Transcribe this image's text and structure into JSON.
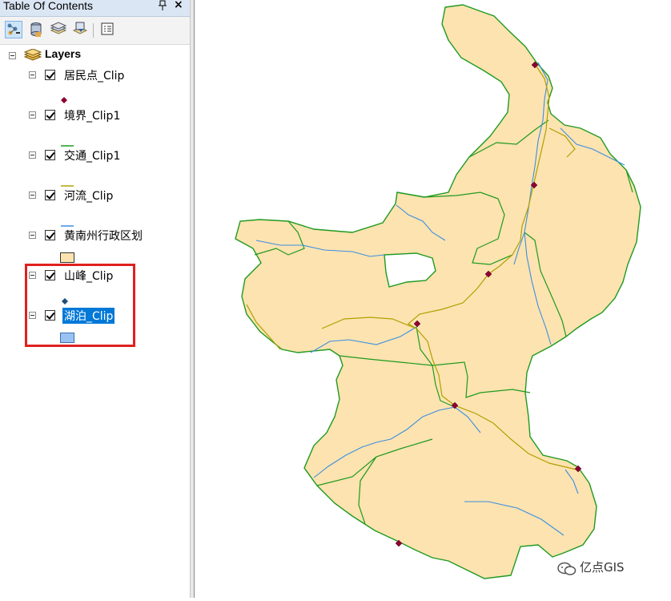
{
  "toc": {
    "title": "Table Of Contents",
    "pin_icon": "pushpin-icon",
    "close_label": "×",
    "toolbar": [
      "list-by-drawing-order-icon",
      "list-by-source-icon",
      "list-by-visibility-icon",
      "list-by-selection-icon",
      "options-icon"
    ],
    "group": {
      "label": "Layers"
    },
    "layers": [
      {
        "name": "居民点_Clip",
        "checked": true,
        "symbol": "point-marker",
        "color": "#8b0035"
      },
      {
        "name": "境界_Clip1",
        "checked": true,
        "symbol": "line",
        "color": "#1f9a1f"
      },
      {
        "name": "交通_Clip1",
        "checked": true,
        "symbol": "line",
        "color": "#b0a000"
      },
      {
        "name": "河流_Clip",
        "checked": true,
        "symbol": "line",
        "color": "#3b8fe0"
      },
      {
        "name": "黄南州行政区划",
        "checked": true,
        "symbol": "fill",
        "color": "#fde3b0"
      },
      {
        "name": "山峰_Clip",
        "checked": true,
        "symbol": "point-marker",
        "color": "#1f4e7a"
      },
      {
        "name": "湖泊_Clip",
        "checked": true,
        "symbol": "fill",
        "color": "#99c2f2",
        "selected": true
      }
    ]
  },
  "map": {
    "fill_color": "#fde3b0",
    "boundary_color": "#1f9a1f",
    "river_color": "#3b8fe0",
    "road_color": "#b0a000",
    "settlement_color": "#8b0035"
  },
  "watermark": "亿点GIS"
}
